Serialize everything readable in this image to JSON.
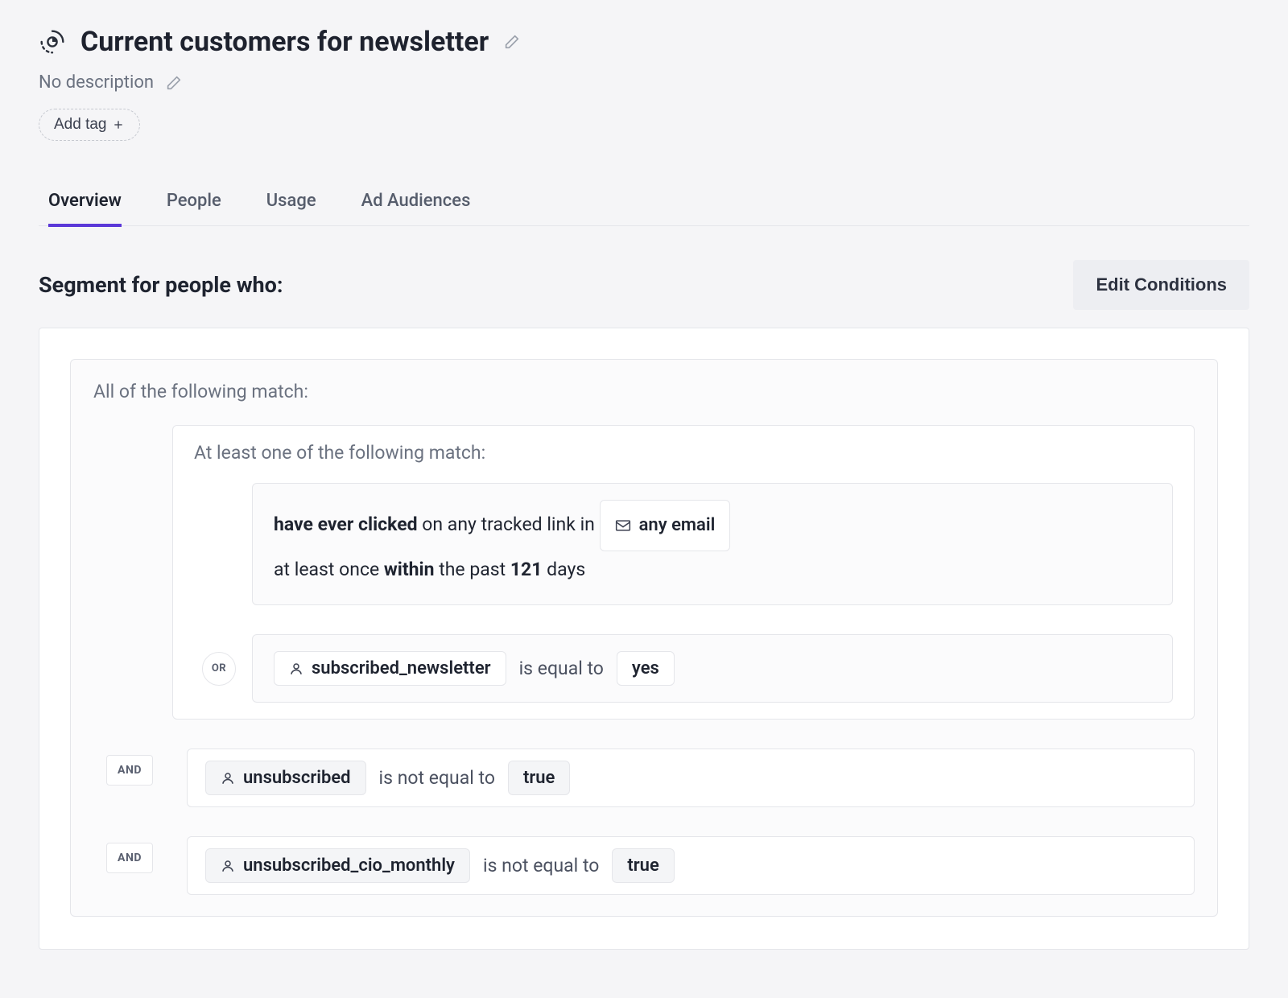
{
  "header": {
    "title": "Current customers for newsletter",
    "description_placeholder": "No description",
    "add_tag_label": "Add tag"
  },
  "tabs": [
    {
      "label": "Overview",
      "active": true
    },
    {
      "label": "People",
      "active": false
    },
    {
      "label": "Usage",
      "active": false
    },
    {
      "label": "Ad Audiences",
      "active": false
    }
  ],
  "segment": {
    "header_label": "Segment for people who:",
    "edit_button_label": "Edit Conditions",
    "outer_group_label": "All of the following match:",
    "or_group_label": "At least one of the following match:",
    "operators": {
      "or": "OR",
      "and": "AND"
    },
    "or_conditions": [
      {
        "type": "event",
        "prefix_bold": "have ever clicked",
        "middle_text": " on any tracked link in ",
        "target_pill": "any email",
        "line2_prefix": "at least once ",
        "line2_bold1": "within",
        "line2_mid": " the past ",
        "line2_bold2": "121",
        "line2_suffix": " days"
      },
      {
        "type": "attribute",
        "attribute": "subscribed_newsletter",
        "operator_text": "is equal to",
        "value": "yes"
      }
    ],
    "and_conditions": [
      {
        "attribute": "unsubscribed",
        "operator_text": "is not equal to",
        "value": "true"
      },
      {
        "attribute": "unsubscribed_cio_monthly",
        "operator_text": "is not equal to",
        "value": "true"
      }
    ]
  },
  "icons": {
    "segment": "segment-icon",
    "pencil": "pencil-icon",
    "plus": "plus-icon",
    "envelope": "envelope-icon",
    "person": "person-icon"
  }
}
